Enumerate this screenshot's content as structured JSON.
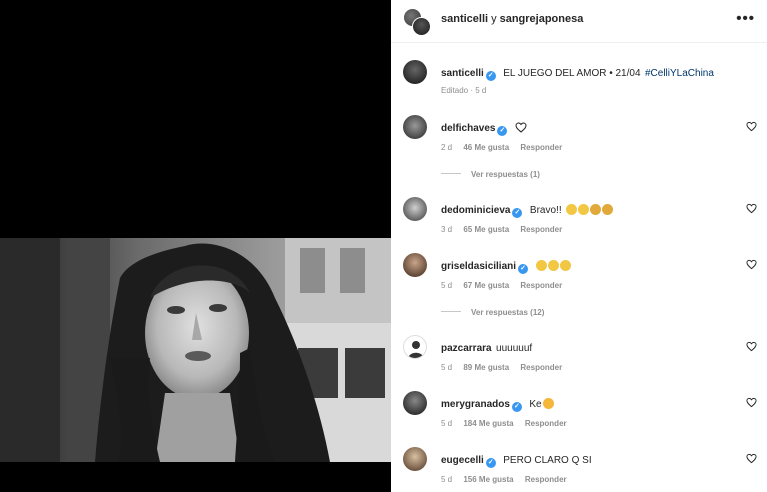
{
  "header": {
    "user1": "santicelli",
    "joiner": "y",
    "user2": "sangrejaponesa",
    "more_label": "•••"
  },
  "caption": {
    "username": "santicelli",
    "text": "EL JUEGO DEL AMOR • 21/04",
    "hashtag": "#CelliYLaChina",
    "meta": "Editado · 5 d"
  },
  "comments": [
    {
      "username": "delfichaves",
      "text": "",
      "emoji": "heart",
      "time": "2 d",
      "likes": "46 Me gusta",
      "reply": "Responder",
      "view_replies": "Ver respuestas (1)"
    },
    {
      "username": "dedominicieva",
      "text": "Bravo!!",
      "emoji": "clap x4",
      "time": "3 d",
      "likes": "65 Me gusta",
      "reply": "Responder"
    },
    {
      "username": "griseldasiciliani",
      "text": "",
      "emoji": "clap x3",
      "time": "5 d",
      "likes": "67 Me gusta",
      "reply": "Responder",
      "view_replies": "Ver respuestas (12)"
    },
    {
      "username": "pazcarrara",
      "text": "uuuuuuf",
      "time": "5 d",
      "likes": "89 Me gusta",
      "reply": "Responder"
    },
    {
      "username": "merygranados",
      "text": "Ke",
      "emoji": "heart-eyes",
      "time": "5 d",
      "likes": "184 Me gusta",
      "reply": "Responder"
    },
    {
      "username": "eugecelli",
      "text": "PERO CLARO Q SI",
      "time": "5 d",
      "likes": "156 Me gusta",
      "reply": "Responder"
    }
  ],
  "colors": {
    "verified": "#3897f0",
    "hashtag": "#00376b",
    "meta": "#8e8e8e"
  }
}
